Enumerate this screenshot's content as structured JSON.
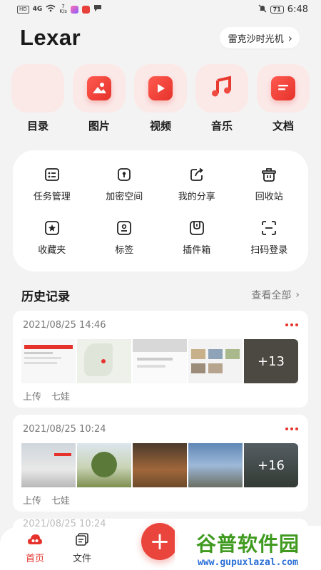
{
  "status_bar": {
    "hd_badge": "HD",
    "signal": "4G",
    "net_speed": "7",
    "net_unit": "K/s",
    "battery": "71",
    "time": "6:48"
  },
  "header": {
    "logo": "Lexar",
    "device_name": "雷克沙时光机"
  },
  "categories": [
    {
      "label": "目录",
      "icon": "grid-icon"
    },
    {
      "label": "图片",
      "icon": "image-icon"
    },
    {
      "label": "视频",
      "icon": "play-icon"
    },
    {
      "label": "音乐",
      "icon": "music-note-icon"
    },
    {
      "label": "文档",
      "icon": "document-icon"
    }
  ],
  "tools": [
    {
      "label": "任务管理",
      "icon": "task-list-icon"
    },
    {
      "label": "加密空间",
      "icon": "lock-icon"
    },
    {
      "label": "我的分享",
      "icon": "share-icon"
    },
    {
      "label": "回收站",
      "icon": "trash-icon"
    },
    {
      "label": "收藏夹",
      "icon": "star-icon"
    },
    {
      "label": "标签",
      "icon": "tag-icon"
    },
    {
      "label": "插件箱",
      "icon": "plugin-icon"
    },
    {
      "label": "扫码登录",
      "icon": "scan-icon"
    }
  ],
  "history": {
    "title": "历史记录",
    "view_all": "查看全部"
  },
  "records": [
    {
      "date": "2021/08/25 14:46",
      "action": "上传",
      "user": "七娃",
      "more_count": "+13"
    },
    {
      "date": "2021/08/25 10:24",
      "action": "上传",
      "user": "七娃",
      "more_count": "+16"
    }
  ],
  "faded_record_date": "2021/08/25 10:24",
  "bottom_nav": {
    "home": "首页",
    "files": "文件"
  },
  "watermark": {
    "title": "谷普软件园",
    "url": "www.gupuxlazal.com"
  },
  "colors": {
    "accent": "#e5322b",
    "tile_bg": "#fbe9e8",
    "page_bg": "#f4f3f3"
  }
}
